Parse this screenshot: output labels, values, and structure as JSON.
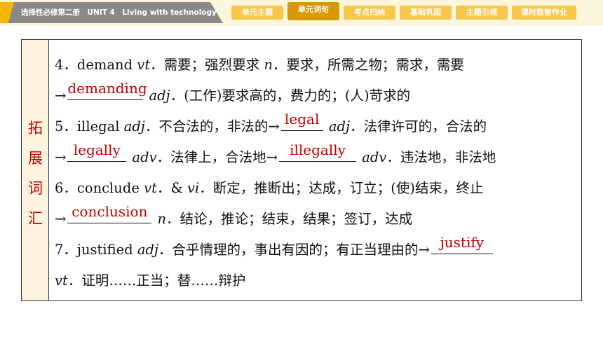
{
  "header": {
    "book_title": "选择性必修第二册　UNIT 4　Living with technology",
    "tabs": [
      {
        "label": "单元主题",
        "active": false
      },
      {
        "label": "单元词句",
        "active": true
      },
      {
        "label": "考点归纳",
        "active": false
      },
      {
        "label": "基础巩固",
        "active": false
      },
      {
        "label": "主题引领",
        "active": false
      },
      {
        "label": "课时数智作业",
        "active": false
      }
    ]
  },
  "side_label": [
    "拓",
    "展",
    "词",
    "汇"
  ],
  "entries": {
    "e4": {
      "head": "4．demand ",
      "pos1": "vt",
      "def1": "．需要；强烈要求 ",
      "pos2": "n",
      "def2": "．要求，所需之物；需求，需要",
      "arrow": "→",
      "ans": "demanding",
      "pos3": "adj",
      "def3": "．(工作)要求高的，费力的；(人)苛求的"
    },
    "e5": {
      "head": "5．illegal ",
      "pos1": "adj",
      "def1": "．不合法的，非法的→",
      "ans1": "legal",
      "pos2": "adj",
      "def2": "．法律许可的，合法的",
      "arrow": "→",
      "ans2": "legally",
      "pos3": "adv",
      "def3": "．法律上，合法地→",
      "ans3": "illegally",
      "pos4": "adv",
      "def4": "．违法地，非法地"
    },
    "e6": {
      "head": "6．conclude ",
      "pos1": "vt",
      "amp": "．& ",
      "pos2": "vi",
      "def1": "．断定，推断出；达成，订立；(使)结束，终止",
      "arrow": "→",
      "ans": "conclusion",
      "pos3": "n",
      "def2": "．结论，推论；结束，结果；签订，达成"
    },
    "e7": {
      "head": "7．justified ",
      "pos1": "adj",
      "def1": "．合乎情理的，事出有因的；有正当理由的→",
      "ans": "justify",
      "pos2": "vt",
      "def2": "．证明……正当；替……辩护"
    }
  },
  "colors": {
    "answer": "#c00000",
    "side_text": "#c00000",
    "tab": "#f7c64a",
    "tab_active": "#d89a00",
    "header_bg": "#fbf6dc",
    "title_bg": "#8a8a8a"
  }
}
